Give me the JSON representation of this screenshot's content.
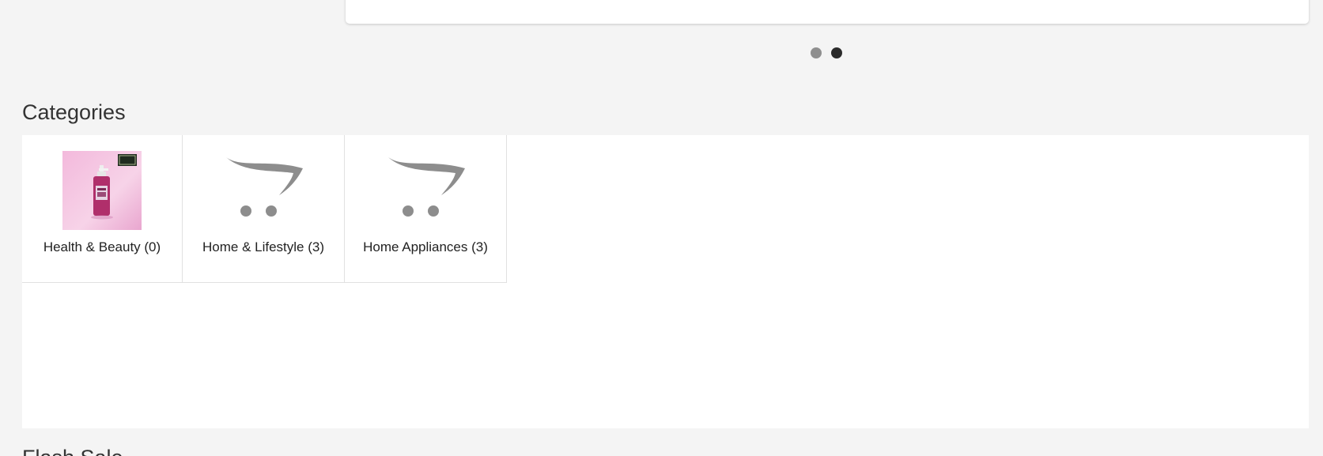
{
  "slider": {
    "dots": [
      {
        "label": "slide-1",
        "active": false
      },
      {
        "label": "slide-2",
        "active": true
      }
    ]
  },
  "categories": {
    "title": "Categories",
    "items": [
      {
        "label": "Health & Beauty (0)",
        "image": "product-photo"
      },
      {
        "label": "Home & Lifestyle (3)",
        "image": "placeholder-cart-icon"
      },
      {
        "label": "Home Appliances (3)",
        "image": "placeholder-cart-icon"
      }
    ]
  },
  "next_section": {
    "title": "Flash Sale"
  },
  "colors": {
    "page_bg": "#f4f4f4",
    "panel_bg": "#ffffff",
    "dot_inactive": "#8f8f8f",
    "dot_active": "#2b2b2b",
    "placeholder_gray": "#8a8a8a"
  }
}
